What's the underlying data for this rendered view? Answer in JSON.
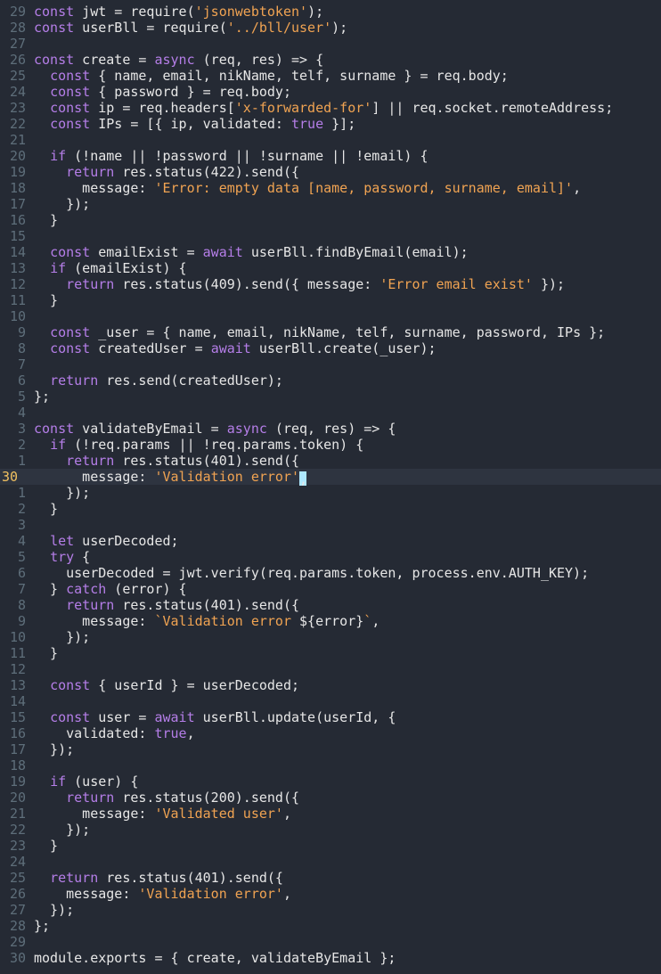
{
  "editor": {
    "cursor_line": 30,
    "lines": [
      {
        "ln": "29",
        "segments": [
          [
            "kw",
            "const"
          ],
          [
            "p",
            " jwt = require("
          ],
          [
            "str",
            "'jsonwebtoken'"
          ],
          [
            "p",
            ");"
          ]
        ]
      },
      {
        "ln": "28",
        "segments": [
          [
            "kw",
            "const"
          ],
          [
            "p",
            " userBll = require("
          ],
          [
            "str",
            "'../bll/user'"
          ],
          [
            "p",
            ");"
          ]
        ]
      },
      {
        "ln": "27",
        "segments": []
      },
      {
        "ln": "26",
        "segments": [
          [
            "kw",
            "const"
          ],
          [
            "p",
            " create = "
          ],
          [
            "kw",
            "async"
          ],
          [
            "p",
            " (req, res) => {"
          ]
        ]
      },
      {
        "ln": "25",
        "segments": [
          [
            "p",
            "  "
          ],
          [
            "kw",
            "const"
          ],
          [
            "p",
            " { name, email, nikName, telf, surname } = req.body;"
          ]
        ]
      },
      {
        "ln": "24",
        "segments": [
          [
            "p",
            "  "
          ],
          [
            "kw",
            "const"
          ],
          [
            "p",
            " { password } = req.body;"
          ]
        ]
      },
      {
        "ln": "23",
        "segments": [
          [
            "p",
            "  "
          ],
          [
            "kw",
            "const"
          ],
          [
            "p",
            " ip = req.headers["
          ],
          [
            "str",
            "'x-forwarded-for'"
          ],
          [
            "p",
            "] || req.socket.remoteAddress;"
          ]
        ]
      },
      {
        "ln": "22",
        "segments": [
          [
            "p",
            "  "
          ],
          [
            "kw",
            "const"
          ],
          [
            "p",
            " IPs = [{ ip, validated: "
          ],
          [
            "bool",
            "true"
          ],
          [
            "p",
            " }];"
          ]
        ]
      },
      {
        "ln": "21",
        "segments": []
      },
      {
        "ln": "20",
        "segments": [
          [
            "p",
            "  "
          ],
          [
            "kw",
            "if"
          ],
          [
            "p",
            " (!name || !password || !surname || !email) {"
          ]
        ]
      },
      {
        "ln": "19",
        "segments": [
          [
            "p",
            "    "
          ],
          [
            "kw",
            "return"
          ],
          [
            "p",
            " res.status(422).send({"
          ]
        ]
      },
      {
        "ln": "18",
        "segments": [
          [
            "p",
            "      message: "
          ],
          [
            "str",
            "'Error: empty data [name, password, surname, email]'"
          ],
          [
            "p",
            ","
          ]
        ]
      },
      {
        "ln": "17",
        "segments": [
          [
            "p",
            "    });"
          ]
        ]
      },
      {
        "ln": "16",
        "segments": [
          [
            "p",
            "  }"
          ]
        ]
      },
      {
        "ln": "15",
        "segments": []
      },
      {
        "ln": "14",
        "segments": [
          [
            "p",
            "  "
          ],
          [
            "kw",
            "const"
          ],
          [
            "p",
            " emailExist = "
          ],
          [
            "kw",
            "await"
          ],
          [
            "p",
            " userBll.findByEmail(email);"
          ]
        ]
      },
      {
        "ln": "13",
        "segments": [
          [
            "p",
            "  "
          ],
          [
            "kw",
            "if"
          ],
          [
            "p",
            " (emailExist) {"
          ]
        ]
      },
      {
        "ln": "12",
        "segments": [
          [
            "p",
            "    "
          ],
          [
            "kw",
            "return"
          ],
          [
            "p",
            " res.status(409).send({ message: "
          ],
          [
            "str",
            "'Error email exist'"
          ],
          [
            "p",
            " });"
          ]
        ]
      },
      {
        "ln": "11",
        "segments": [
          [
            "p",
            "  }"
          ]
        ]
      },
      {
        "ln": "10",
        "segments": []
      },
      {
        "ln": "9",
        "segments": [
          [
            "p",
            "  "
          ],
          [
            "kw",
            "const"
          ],
          [
            "p",
            " _user = { name, email, nikName, telf, surname, password, IPs };"
          ]
        ]
      },
      {
        "ln": "8",
        "segments": [
          [
            "p",
            "  "
          ],
          [
            "kw",
            "const"
          ],
          [
            "p",
            " createdUser = "
          ],
          [
            "kw",
            "await"
          ],
          [
            "p",
            " userBll.create(_user);"
          ]
        ]
      },
      {
        "ln": "7",
        "segments": []
      },
      {
        "ln": "6",
        "segments": [
          [
            "p",
            "  "
          ],
          [
            "kw",
            "return"
          ],
          [
            "p",
            " res.send(createdUser);"
          ]
        ]
      },
      {
        "ln": "5",
        "segments": [
          [
            "p",
            "};"
          ]
        ]
      },
      {
        "ln": "4",
        "segments": []
      },
      {
        "ln": "3",
        "segments": [
          [
            "kw",
            "const"
          ],
          [
            "p",
            " validateByEmail = "
          ],
          [
            "kw",
            "async"
          ],
          [
            "p",
            " (req, res) => {"
          ]
        ]
      },
      {
        "ln": "2",
        "segments": [
          [
            "p",
            "  "
          ],
          [
            "kw",
            "if"
          ],
          [
            "p",
            " (!req.params || !req.params.token) {"
          ]
        ]
      },
      {
        "ln": "1",
        "segments": [
          [
            "p",
            "    "
          ],
          [
            "kw",
            "return"
          ],
          [
            "p",
            " res.status(401).send({"
          ]
        ]
      },
      {
        "ln": "30",
        "current": true,
        "segments": [
          [
            "p",
            "      message: "
          ],
          [
            "str",
            "'Validation error'"
          ],
          [
            "cursor",
            ","
          ]
        ]
      },
      {
        "ln": "1",
        "segments": [
          [
            "p",
            "    });"
          ]
        ]
      },
      {
        "ln": "2",
        "segments": [
          [
            "p",
            "  }"
          ]
        ]
      },
      {
        "ln": "3",
        "segments": []
      },
      {
        "ln": "4",
        "segments": [
          [
            "p",
            "  "
          ],
          [
            "kw",
            "let"
          ],
          [
            "p",
            " userDecoded;"
          ]
        ]
      },
      {
        "ln": "5",
        "segments": [
          [
            "p",
            "  "
          ],
          [
            "kw",
            "try"
          ],
          [
            "p",
            " {"
          ]
        ]
      },
      {
        "ln": "6",
        "segments": [
          [
            "p",
            "    userDecoded = jwt.verify(req.params.token, process.env.AUTH_KEY);"
          ]
        ]
      },
      {
        "ln": "7",
        "segments": [
          [
            "p",
            "  } "
          ],
          [
            "kw",
            "catch"
          ],
          [
            "p",
            " (error) {"
          ]
        ]
      },
      {
        "ln": "8",
        "segments": [
          [
            "p",
            "    "
          ],
          [
            "kw",
            "return"
          ],
          [
            "p",
            " res.status(401).send({"
          ]
        ]
      },
      {
        "ln": "9",
        "segments": [
          [
            "p",
            "      message: "
          ],
          [
            "str",
            "`Validation error "
          ],
          [
            "p",
            "${error}"
          ],
          [
            "str",
            "`"
          ],
          [
            "p",
            ","
          ]
        ]
      },
      {
        "ln": "10",
        "segments": [
          [
            "p",
            "    });"
          ]
        ]
      },
      {
        "ln": "11",
        "segments": [
          [
            "p",
            "  }"
          ]
        ]
      },
      {
        "ln": "12",
        "segments": []
      },
      {
        "ln": "13",
        "segments": [
          [
            "p",
            "  "
          ],
          [
            "kw",
            "const"
          ],
          [
            "p",
            " { userId } = userDecoded;"
          ]
        ]
      },
      {
        "ln": "14",
        "segments": []
      },
      {
        "ln": "15",
        "segments": [
          [
            "p",
            "  "
          ],
          [
            "kw",
            "const"
          ],
          [
            "p",
            " user = "
          ],
          [
            "kw",
            "await"
          ],
          [
            "p",
            " userBll.update(userId, {"
          ]
        ]
      },
      {
        "ln": "16",
        "segments": [
          [
            "p",
            "    validated: "
          ],
          [
            "bool",
            "true"
          ],
          [
            "p",
            ","
          ]
        ]
      },
      {
        "ln": "17",
        "segments": [
          [
            "p",
            "  });"
          ]
        ]
      },
      {
        "ln": "18",
        "segments": []
      },
      {
        "ln": "19",
        "segments": [
          [
            "p",
            "  "
          ],
          [
            "kw",
            "if"
          ],
          [
            "p",
            " (user) {"
          ]
        ]
      },
      {
        "ln": "20",
        "segments": [
          [
            "p",
            "    "
          ],
          [
            "kw",
            "return"
          ],
          [
            "p",
            " res.status(200).send({"
          ]
        ]
      },
      {
        "ln": "21",
        "segments": [
          [
            "p",
            "      message: "
          ],
          [
            "str",
            "'Validated user'"
          ],
          [
            "p",
            ","
          ]
        ]
      },
      {
        "ln": "22",
        "segments": [
          [
            "p",
            "    });"
          ]
        ]
      },
      {
        "ln": "23",
        "segments": [
          [
            "p",
            "  }"
          ]
        ]
      },
      {
        "ln": "24",
        "segments": []
      },
      {
        "ln": "25",
        "segments": [
          [
            "p",
            "  "
          ],
          [
            "kw",
            "return"
          ],
          [
            "p",
            " res.status(401).send({"
          ]
        ]
      },
      {
        "ln": "26",
        "segments": [
          [
            "p",
            "    message: "
          ],
          [
            "str",
            "'Validation error'"
          ],
          [
            "p",
            ","
          ]
        ]
      },
      {
        "ln": "27",
        "segments": [
          [
            "p",
            "  });"
          ]
        ]
      },
      {
        "ln": "28",
        "segments": [
          [
            "p",
            "};"
          ]
        ]
      },
      {
        "ln": "29",
        "segments": []
      },
      {
        "ln": "30",
        "segments": [
          [
            "p",
            "module.exports = { create, validateByEmail };"
          ]
        ]
      }
    ]
  }
}
